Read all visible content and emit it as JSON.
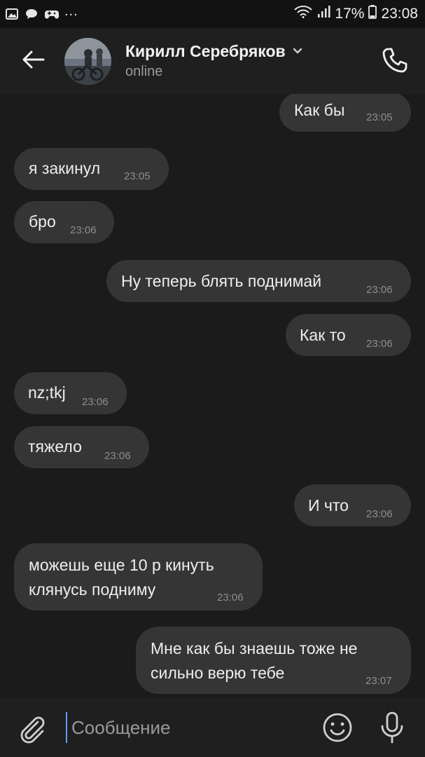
{
  "status_bar": {
    "dots": "...",
    "battery": "17%",
    "time": "23:08",
    "icons": [
      "gallery-icon",
      "chat-icon",
      "gamepad-icon",
      "wifi-icon",
      "signal-icon",
      "battery-icon"
    ]
  },
  "header": {
    "name": "Кирилл Серебряков",
    "status": "online",
    "back_icon": "arrow-left-icon",
    "call_icon": "phone-icon"
  },
  "messages": [
    {
      "side": "out",
      "text": "Как бы",
      "time": "23:05"
    },
    {
      "side": "in",
      "text": "я закинул",
      "time": "23:05"
    },
    {
      "side": "in",
      "text": "бро",
      "time": "23:06"
    },
    {
      "side": "out",
      "text": "Ну теперь блять поднимай",
      "time": "23:06"
    },
    {
      "side": "out",
      "text": "Как то",
      "time": "23:06"
    },
    {
      "side": "in",
      "text": "nz;tkj",
      "time": "23:06"
    },
    {
      "side": "in",
      "text": "тяжело",
      "time": "23:06"
    },
    {
      "side": "out",
      "text": "И что",
      "time": "23:06"
    },
    {
      "side": "in",
      "text_lines": [
        "можешь еще 10 р кинуть",
        "клянусь подниму"
      ],
      "time": "23:06"
    },
    {
      "side": "out",
      "text_lines": [
        "Мне как бы знаешь тоже не",
        "сильно верю тебе"
      ],
      "time": "23:07"
    }
  ],
  "composer": {
    "placeholder": "Сообщение",
    "value": ""
  },
  "colors": {
    "background": "#1b1b1b",
    "bubble": "#353535",
    "header": "#1f1f1f",
    "text": "#eeeeee",
    "time": "#8d8d8d"
  }
}
